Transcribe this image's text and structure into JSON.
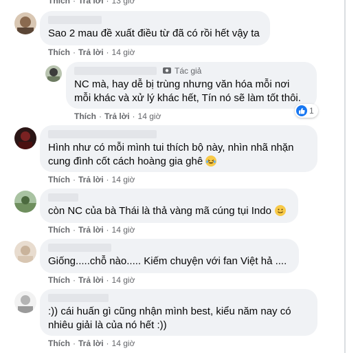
{
  "actions": {
    "like": "Thích",
    "reply": "Trả lời",
    "separator": "·"
  },
  "top_partial": {
    "time": "13 giờ"
  },
  "comments": [
    {
      "text": "Sao 2 mau đề xuất điều từ đã có rồi hết vậy ta",
      "time": "14 giờ"
    },
    {
      "author_badge": "Tác giả",
      "text": "NC mà, hay dễ bị trùng nhưng văn hóa mỗi nơi\nmỗi khác và xử lý khác hết, Tín nó sẽ làm tốt thôi.",
      "time": "14 giờ",
      "reaction_count": "1"
    },
    {
      "text": "Hình như có mỗi mình tui thích bộ này, nhìn nhã nhặn\ncung đình cốt cách hoàng gia ghê",
      "emoji": "laughing-tears-emoji",
      "time": "14 giờ"
    },
    {
      "text": "còn NC của bà Thái là thả vàng mã cúng tụi Indo",
      "emoji": "smiling-face-emoji",
      "time": "14 giờ"
    },
    {
      "text": "Giống.....chỗ nào..... Kiếm chuyện với fan Việt hả ....",
      "time": "14 giờ"
    },
    {
      "text": ":)) cái huấn gì cũng nhận mình best, kiểu năm nay có\nnhiêu giải là của nó hết :))",
      "time": "14 giờ"
    }
  ],
  "colors": {
    "bubble": "#f0f2f5",
    "meta": "#65676b",
    "text": "#050505",
    "like_blue": "#1877f2"
  }
}
